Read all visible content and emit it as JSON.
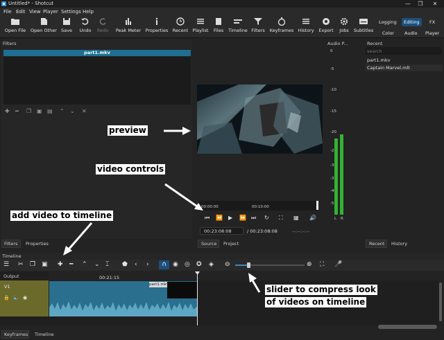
{
  "window": {
    "title": "Untitled* - Shotcut",
    "minimize": "—",
    "restore": "❐",
    "close": "✕"
  },
  "menu": [
    "File",
    "Edit",
    "View",
    "Player",
    "Settings",
    "Help"
  ],
  "toolbar": {
    "open_file": "Open File",
    "open_other": "Open Other",
    "save": "Save",
    "undo": "Undo",
    "redo": "Redo",
    "peak_meter": "Peak Meter",
    "properties": "Properties",
    "recent": "Recent",
    "playlist": "Playlist",
    "files": "Files",
    "timeline": "Timeline",
    "filters": "Filters",
    "keyframes": "Keyframes",
    "history": "History",
    "export": "Export",
    "jobs": "Jobs",
    "subtitles": "Subtitles",
    "logging": "Logging",
    "editing": "Editing",
    "fx": "FX",
    "color": "Color",
    "audio": "Audio",
    "player": "Player"
  },
  "filters_panel": {
    "title": "Filters",
    "clip_name": "part1.mkv"
  },
  "audio_panel": {
    "title": "Audio P...",
    "scale": [
      "0",
      "-5",
      "-10",
      "-15",
      "-20",
      "-25",
      "-30",
      "-35",
      "-40",
      "-50"
    ],
    "left": "L",
    "right": "R"
  },
  "recent_panel": {
    "title": "Recent",
    "search_placeholder": "search",
    "items": [
      "part1.mkv",
      "Captain Marvel.mlt"
    ]
  },
  "player": {
    "ruler_start": "00:00:00",
    "ruler_mid": "00:10:00",
    "position": "00:23:08:08",
    "duration": "/ 00:23:08:08",
    "in_out": "--:--:--:--"
  },
  "tabs": {
    "filters": "Filters",
    "properties": "Properties",
    "source": "Source",
    "project": "Project",
    "recent": "Recent",
    "history": "History",
    "keyframes": "Keyframes",
    "timeline": "Timeline"
  },
  "timeline": {
    "title": "Timeline",
    "output": "Output",
    "track": "V1",
    "ruler_time": "00:21:15",
    "clip_name": "part1.mkv"
  },
  "annotations": {
    "preview": "preview",
    "video_controls": "video controls",
    "add_video": "add video to timeline",
    "slider_line1": "slider to compress look",
    "slider_line2": "of videos on timeline"
  },
  "colors": {
    "accent": "#1e6f93",
    "track_header": "#6b6a2a",
    "meter": "#33b233",
    "editing_active": "#1c4f7c"
  }
}
